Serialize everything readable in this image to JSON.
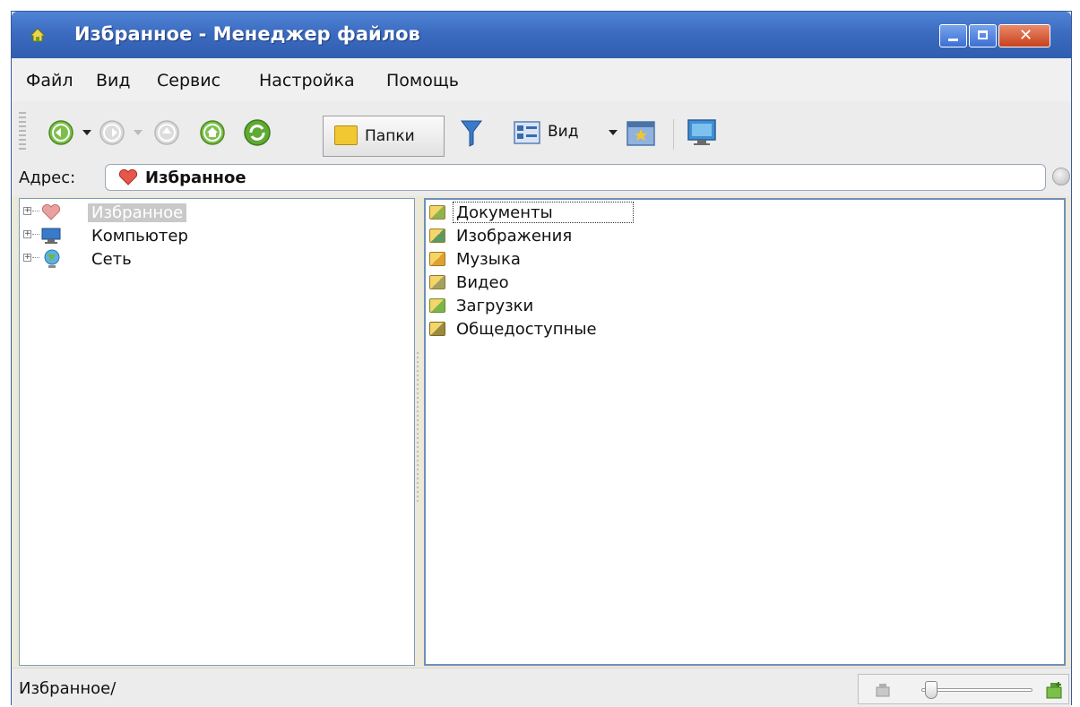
{
  "window": {
    "title": "Избранное - Менеджер файлов"
  },
  "menubar": {
    "items": [
      "Файл",
      "Вид",
      "Сервис",
      "Настройка",
      "Помощь"
    ]
  },
  "toolbar": {
    "folders_label": "Папки",
    "view_label": "Вид"
  },
  "address": {
    "label": "Адрес:",
    "value": "Избранное"
  },
  "tree": {
    "items": [
      {
        "label": "Избранное",
        "icon": "favorites-heart-icon",
        "selected": true
      },
      {
        "label": "Компьютер",
        "icon": "computer-icon",
        "selected": false
      },
      {
        "label": "Сеть",
        "icon": "network-globe-icon",
        "selected": false
      }
    ]
  },
  "files": {
    "items": [
      {
        "name": "Документы",
        "icon": "documents-folder-icon",
        "color": "#8fb34a"
      },
      {
        "name": "Изображения",
        "icon": "pictures-folder-icon",
        "color": "#6fa86a"
      },
      {
        "name": "Музыка",
        "icon": "music-folder-icon",
        "color": "#e0a030"
      },
      {
        "name": "Видео",
        "icon": "video-folder-icon",
        "color": "#a6a060"
      },
      {
        "name": "Загрузки",
        "icon": "downloads-folder-icon",
        "color": "#7ab54a"
      },
      {
        "name": "Общедоступные",
        "icon": "public-folder-icon",
        "color": "#9a8a40"
      }
    ]
  },
  "status": {
    "path": "Избранное/",
    "zoom_level_fraction": 0.05
  }
}
